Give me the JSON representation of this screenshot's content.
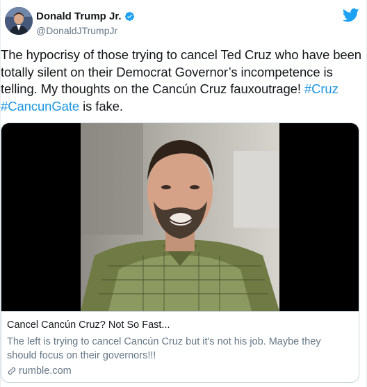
{
  "user": {
    "display_name": "Donald Trump Jr.",
    "handle": "@DonaldJTrumpJr",
    "verified_icon": "verified-badge-icon",
    "avatar_icon": "avatar"
  },
  "brand": {
    "icon": "twitter-bird-icon",
    "color": "#1da1f2"
  },
  "tweet": {
    "text_plain": "The hypocrisy of those trying to cancel Ted Cruz who have been totally silent on their Democrat Governor’s incompetence is telling. My thoughts on the Cancún Cruz fauxoutrage! ",
    "hashtag_1": "#Cruz",
    "space": " ",
    "hashtag_2": "#CancunGate",
    "text_end": " is fake.",
    "hashtag_color": "#1b95e0"
  },
  "card": {
    "title": "Cancel Cancún Cruz? Not So Fast...",
    "description": "The left is trying to cancel Cancún Cruz but it's not his job. Maybe they should focus on their governors!!!",
    "domain": "rumble.com",
    "link_icon": "link-icon"
  }
}
